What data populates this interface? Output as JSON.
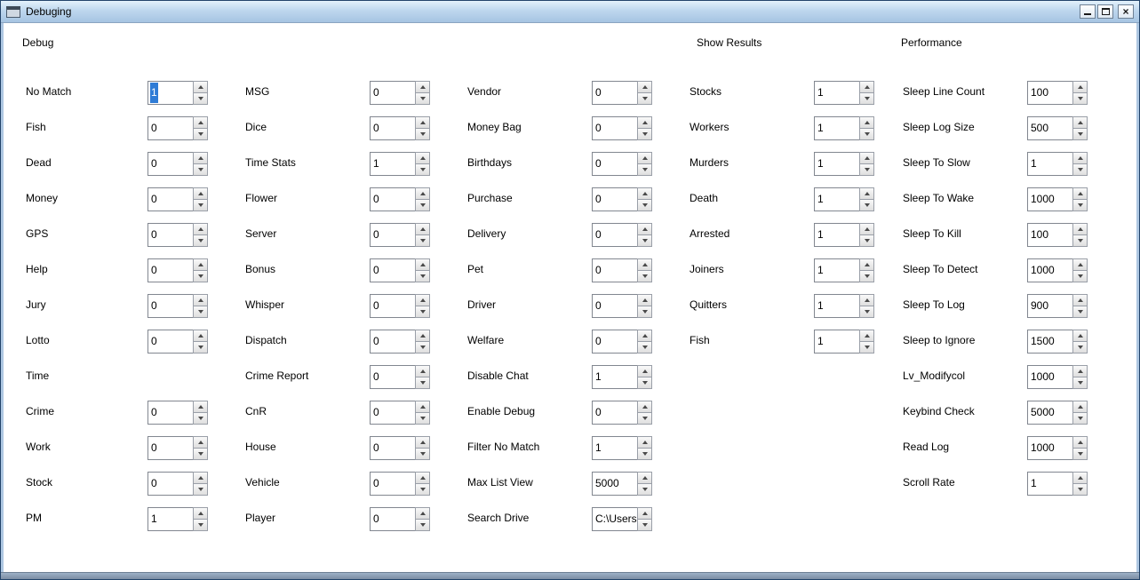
{
  "window": {
    "title": "Debuging",
    "icons": {
      "close_glyph": "×"
    }
  },
  "columns": [
    {
      "header": "Debug",
      "rows": [
        {
          "label": "No Match",
          "value": "1",
          "selected": true
        },
        {
          "label": "Fish",
          "value": "0"
        },
        {
          "label": "Dead",
          "value": "0"
        },
        {
          "label": "Money",
          "value": "0"
        },
        {
          "label": "GPS",
          "value": "0"
        },
        {
          "label": "Help",
          "value": "0"
        },
        {
          "label": "Jury",
          "value": "0"
        },
        {
          "label": "Lotto",
          "value": "0"
        },
        {
          "label": "Time",
          "value": null
        },
        {
          "label": "Crime",
          "value": "0"
        },
        {
          "label": "Work",
          "value": "0"
        },
        {
          "label": "Stock",
          "value": "0"
        },
        {
          "label": "PM",
          "value": "1"
        }
      ]
    },
    {
      "header": "",
      "rows": [
        {
          "label": "MSG",
          "value": "0"
        },
        {
          "label": "Dice",
          "value": "0"
        },
        {
          "label": "Time Stats",
          "value": "1"
        },
        {
          "label": "Flower",
          "value": "0"
        },
        {
          "label": "Server",
          "value": "0"
        },
        {
          "label": "Bonus",
          "value": "0"
        },
        {
          "label": "Whisper",
          "value": "0"
        },
        {
          "label": "Dispatch",
          "value": "0"
        },
        {
          "label": "Crime Report",
          "value": "0"
        },
        {
          "label": "CnR",
          "value": "0"
        },
        {
          "label": "House",
          "value": "0"
        },
        {
          "label": "Vehicle",
          "value": "0"
        },
        {
          "label": "Player",
          "value": "0"
        }
      ]
    },
    {
      "header": "",
      "rows": [
        {
          "label": "Vendor",
          "value": "0"
        },
        {
          "label": "Money Bag",
          "value": "0"
        },
        {
          "label": "Birthdays",
          "value": "0"
        },
        {
          "label": "Purchase",
          "value": "0"
        },
        {
          "label": "Delivery",
          "value": "0"
        },
        {
          "label": "Pet",
          "value": "0"
        },
        {
          "label": "Driver",
          "value": "0"
        },
        {
          "label": "Welfare",
          "value": "0"
        },
        {
          "label": "Disable Chat",
          "value": "1"
        },
        {
          "label": "Enable Debug",
          "value": "0"
        },
        {
          "label": "Filter No Match",
          "value": "1"
        },
        {
          "label": "Max List View",
          "value": "5000"
        },
        {
          "label": "Search Drive",
          "value": "C:\\Users"
        }
      ]
    },
    {
      "header": "Show Results",
      "rows": [
        {
          "label": "Stocks",
          "value": "1"
        },
        {
          "label": "Workers",
          "value": "1"
        },
        {
          "label": "Murders",
          "value": "1"
        },
        {
          "label": "Death",
          "value": "1"
        },
        {
          "label": "Arrested",
          "value": "1"
        },
        {
          "label": "Joiners",
          "value": "1"
        },
        {
          "label": "Quitters",
          "value": "1"
        },
        {
          "label": "Fish",
          "value": "1"
        }
      ]
    },
    {
      "header": "Performance",
      "rows": [
        {
          "label": "Sleep Line Count",
          "value": "100"
        },
        {
          "label": "Sleep Log Size",
          "value": "500"
        },
        {
          "label": "Sleep To Slow",
          "value": "1"
        },
        {
          "label": "Sleep To Wake",
          "value": "1000"
        },
        {
          "label": "Sleep To Kill",
          "value": "100"
        },
        {
          "label": "Sleep To Detect",
          "value": "1000"
        },
        {
          "label": "Sleep To Log",
          "value": "900"
        },
        {
          "label": "Sleep to Ignore",
          "value": "1500"
        },
        {
          "label": "Lv_Modifycol",
          "value": "1000"
        },
        {
          "label": "Keybind Check",
          "value": "5000"
        },
        {
          "label": "Read Log",
          "value": "1000"
        },
        {
          "label": "Scroll Rate",
          "value": "1"
        }
      ]
    }
  ]
}
